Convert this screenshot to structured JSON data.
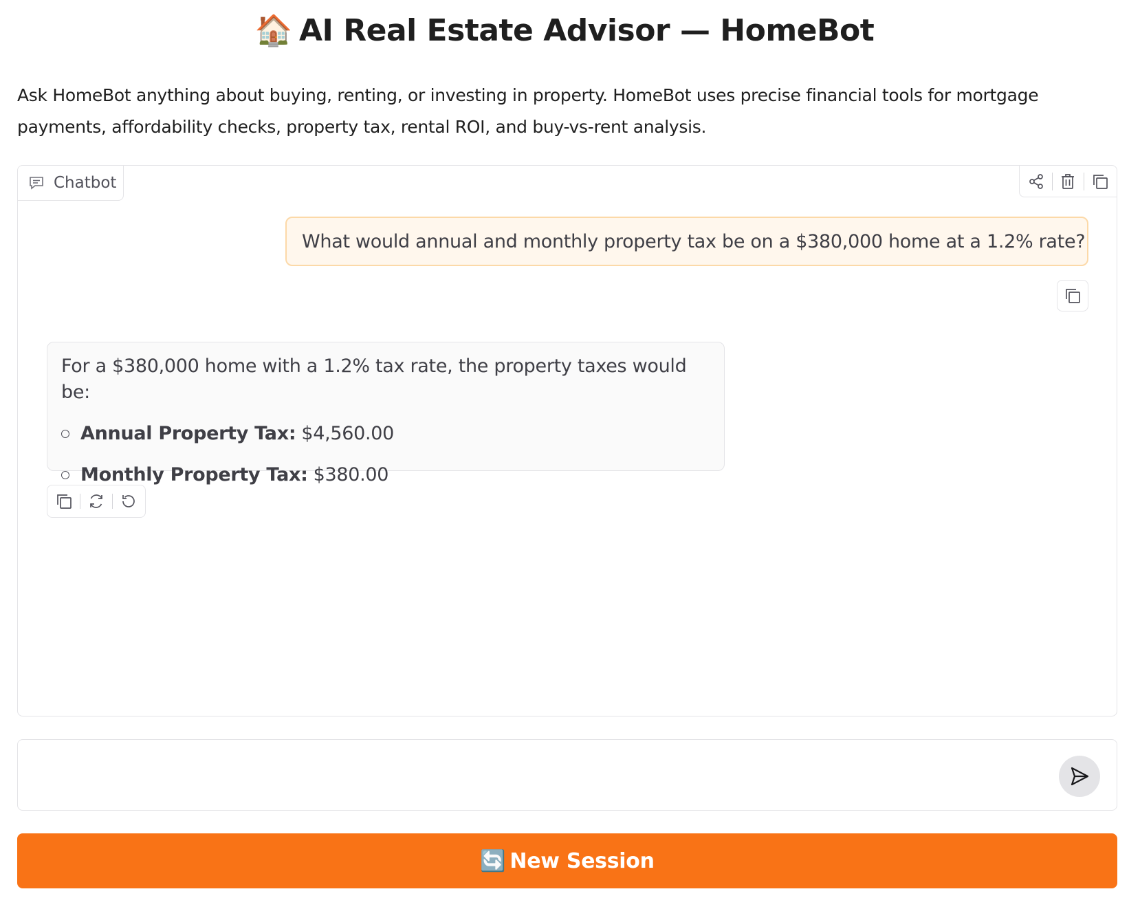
{
  "header": {
    "icon": "house-emoji",
    "icon_glyph": "🏠",
    "title": "AI Real Estate Advisor — HomeBot"
  },
  "description": "Ask HomeBot anything about buying, renting, or investing in property. HomeBot uses precise financial tools for mortgage payments, affordability checks, property tax, rental ROI, and buy-vs-rent analysis.",
  "chatbot": {
    "label": "Chatbot",
    "label_icon": "chat-bubble-icon",
    "top_actions": [
      "share-icon",
      "trash-icon",
      "copy-icon"
    ],
    "messages": [
      {
        "role": "user",
        "text": "What would annual and monthly property tax be on a $380,000 home at a 1.2% rate?"
      },
      {
        "role": "assistant",
        "intro": "For a $380,000 home with a 1.2% tax rate, the property taxes would be:",
        "items": [
          {
            "label": "Annual Property Tax:",
            "value": "$4,560.00"
          },
          {
            "label": "Monthly Property Tax:",
            "value": "$380.00"
          }
        ],
        "actions": [
          "copy-icon",
          "retry-icon",
          "undo-icon"
        ]
      }
    ]
  },
  "input": {
    "value": "",
    "placeholder": "",
    "send_icon": "send-icon"
  },
  "new_session": {
    "icon": "refresh-emoji",
    "icon_glyph": "🔄",
    "label": "New Session"
  },
  "colors": {
    "accent": "#f97316",
    "user_bubble_bg": "#fff7ed",
    "user_bubble_border": "#fcd9a8",
    "bot_bubble_bg": "#fafafa"
  }
}
